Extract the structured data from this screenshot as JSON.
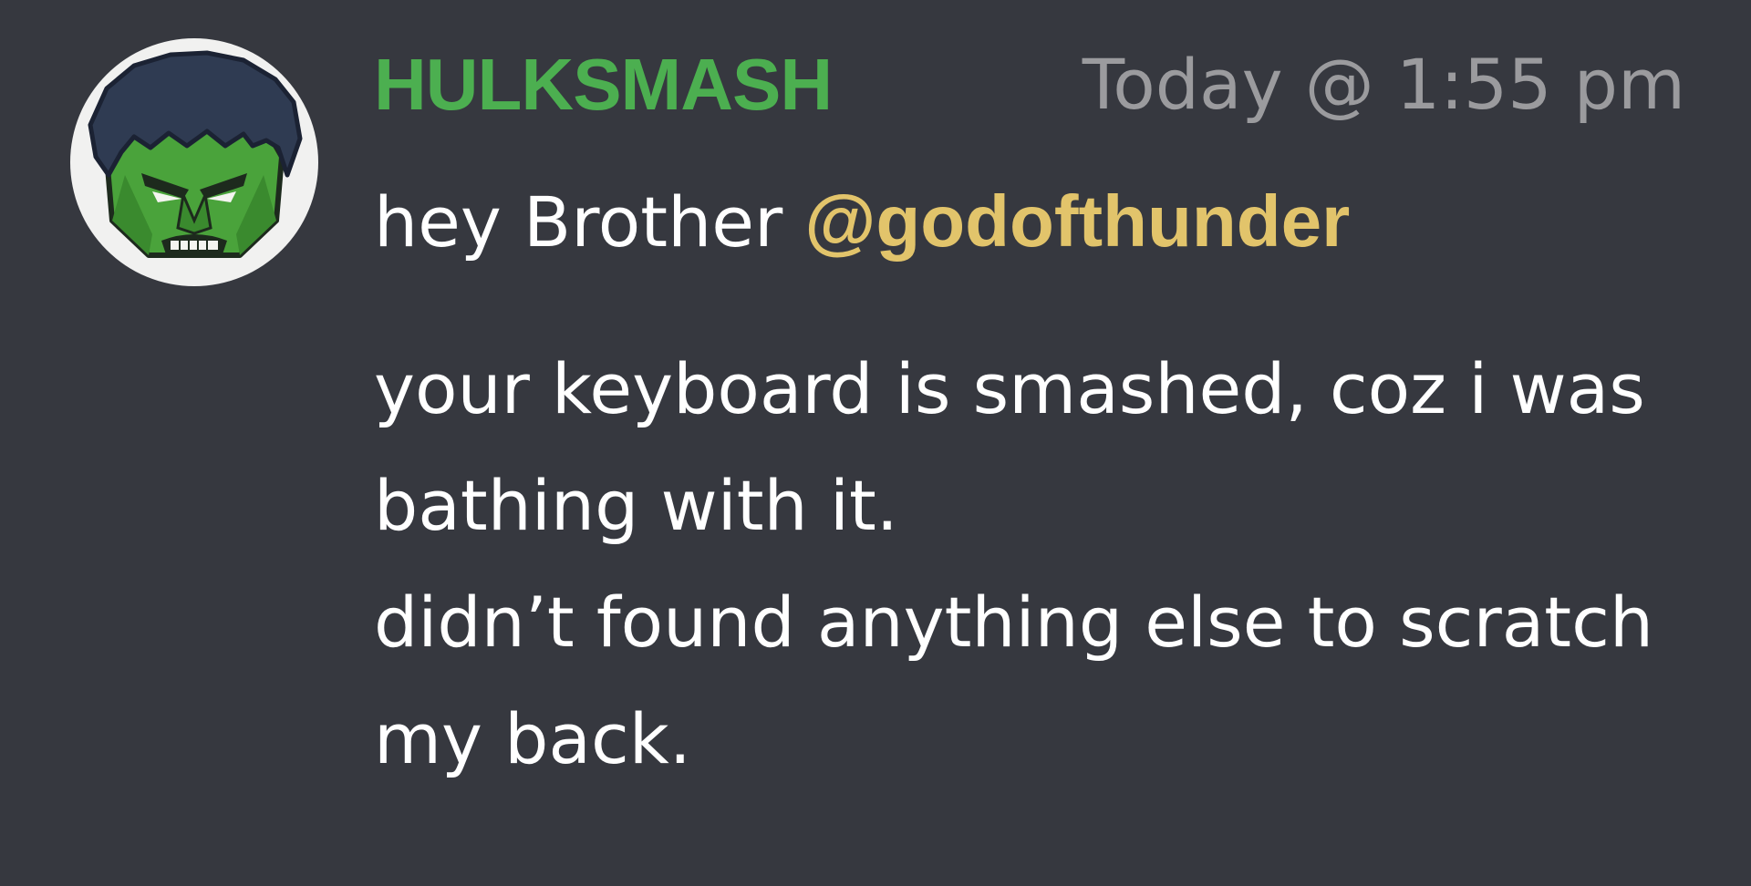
{
  "message": {
    "username": "HULKSMASH",
    "username_color": "#4caf50",
    "timestamp": "Today @ 1:55 pm",
    "avatar_icon": "hulk-face-icon",
    "line1_prefix": "hey Brother ",
    "mention": "@godofthunder",
    "mention_color": "#e2c46b",
    "paragraph2_line1": "your keyboard is smashed, coz i was",
    "paragraph2_line2": "bathing with it.",
    "paragraph3_line1": "didn’t found anything else to scratch",
    "paragraph3_line2": "my back."
  }
}
